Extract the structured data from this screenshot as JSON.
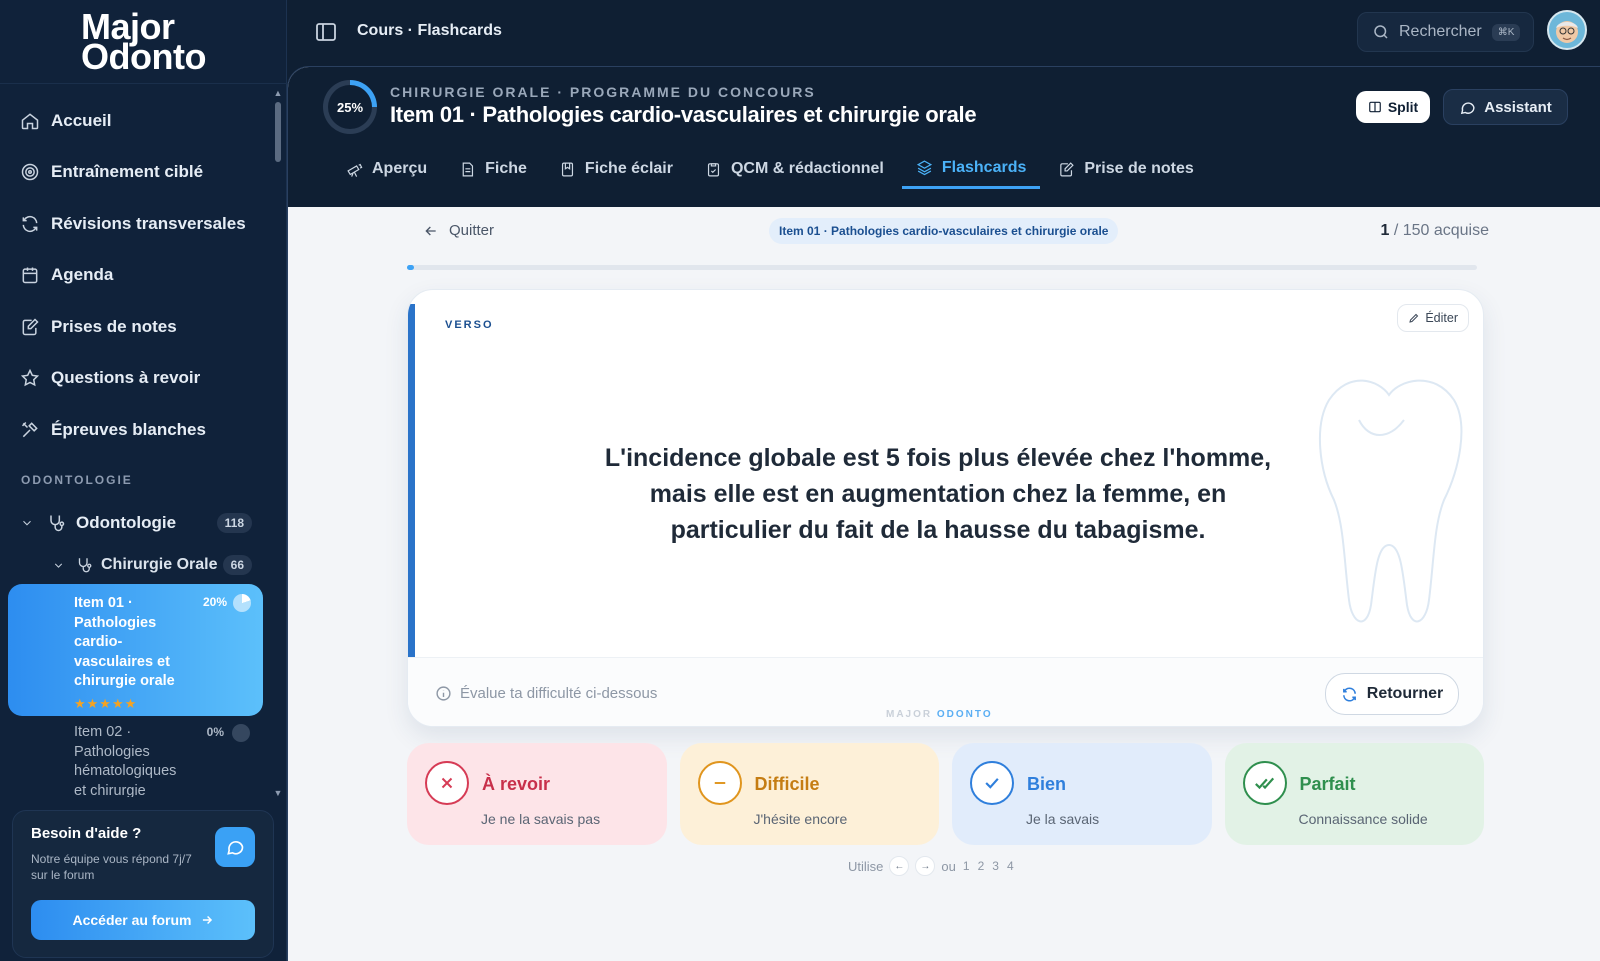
{
  "app": {
    "logo_line1": "Major",
    "logo_line2": "Odonto",
    "brand_color": "#3da2f5"
  },
  "sidebar": {
    "nav": [
      {
        "label": "Accueil",
        "icon": "home-icon"
      },
      {
        "label": "Entraînement ciblé",
        "icon": "target-icon"
      },
      {
        "label": "Révisions transversales",
        "icon": "refresh-icon"
      },
      {
        "label": "Agenda",
        "icon": "calendar-icon"
      },
      {
        "label": "Prises de notes",
        "icon": "notes-icon"
      },
      {
        "label": "Questions à revoir",
        "icon": "star-icon"
      },
      {
        "label": "Épreuves blanches",
        "icon": "tools-icon"
      }
    ],
    "section_label": "ODONTOLOGIE",
    "tree": {
      "odonto_label": "Odontologie",
      "odonto_count": "118",
      "chir_label": "Chirurgie Orale",
      "chir_count": "66",
      "active_item": {
        "label": "Item 01 · Pathologies cardio-vasculaires et chirurgie orale",
        "percent": "20%",
        "stars": "★★★★★",
        "progress": 0.2
      },
      "next_item": {
        "label": "Item 02 · Pathologies hématologiques et chirurgie",
        "percent": "0%"
      }
    },
    "help": {
      "title": "Besoin d'aide ?",
      "text": "Notre équipe vous répond 7j/7 sur le forum",
      "button": "Accéder au forum"
    }
  },
  "topbar": {
    "breadcrumb": "Cours · Flashcards",
    "search_label": "Rechercher",
    "search_shortcut": "⌘K"
  },
  "course": {
    "progress_label": "25%",
    "progress": 0.25,
    "eyebrow": "CHIRURGIE ORALE · PROGRAMME DU CONCOURS",
    "title": "Item 01 · Pathologies cardio-vasculaires et chirurgie orale",
    "split_label": "Split",
    "assistant_label": "Assistant",
    "tabs": [
      {
        "label": "Aperçu",
        "icon": "telescope-icon"
      },
      {
        "label": "Fiche",
        "icon": "document-icon"
      },
      {
        "label": "Fiche éclair",
        "icon": "bookmark-icon"
      },
      {
        "label": "QCM & rédactionnel",
        "icon": "clipboard-icon"
      },
      {
        "label": "Flashcards",
        "icon": "layers-icon"
      },
      {
        "label": "Prise de notes",
        "icon": "edit-note-icon"
      }
    ],
    "active_tab": "Flashcards"
  },
  "flashcards": {
    "quit_label": "Quitter",
    "chip": "Item 01 · Pathologies cardio-vasculaires et chirurgie orale",
    "acquired_count": "1",
    "acquired_total": "/ 150 acquise",
    "deck_progress": 0.0067,
    "side_label": "VERSO",
    "edit_label": "Éditer",
    "answer": "L'incidence globale est 5 fois plus élevée chez l'homme, mais elle est en augmentation chez la femme, en particulier du fait de la hausse du tabagisme.",
    "hint": "Évalue ta difficulté ci-dessous",
    "watermark_a": "MAJOR",
    "watermark_b": "ODONTO",
    "flip_label": "Retourner",
    "ratings": [
      {
        "title": "À revoir",
        "sub": "Je ne la savais pas",
        "icon": "x-icon"
      },
      {
        "title": "Difficile",
        "sub": "J'hésite encore",
        "icon": "minus-icon"
      },
      {
        "title": "Bien",
        "sub": "Je la savais",
        "icon": "check-icon"
      },
      {
        "title": "Parfait",
        "sub": "Connaissance solide",
        "icon": "double-check-icon"
      }
    ],
    "shortcut_prefix": "Utilise",
    "shortcut_left": "←",
    "shortcut_right": "→",
    "shortcut_or": "ou",
    "shortcut_keys": [
      "1",
      "2",
      "3",
      "4"
    ]
  }
}
